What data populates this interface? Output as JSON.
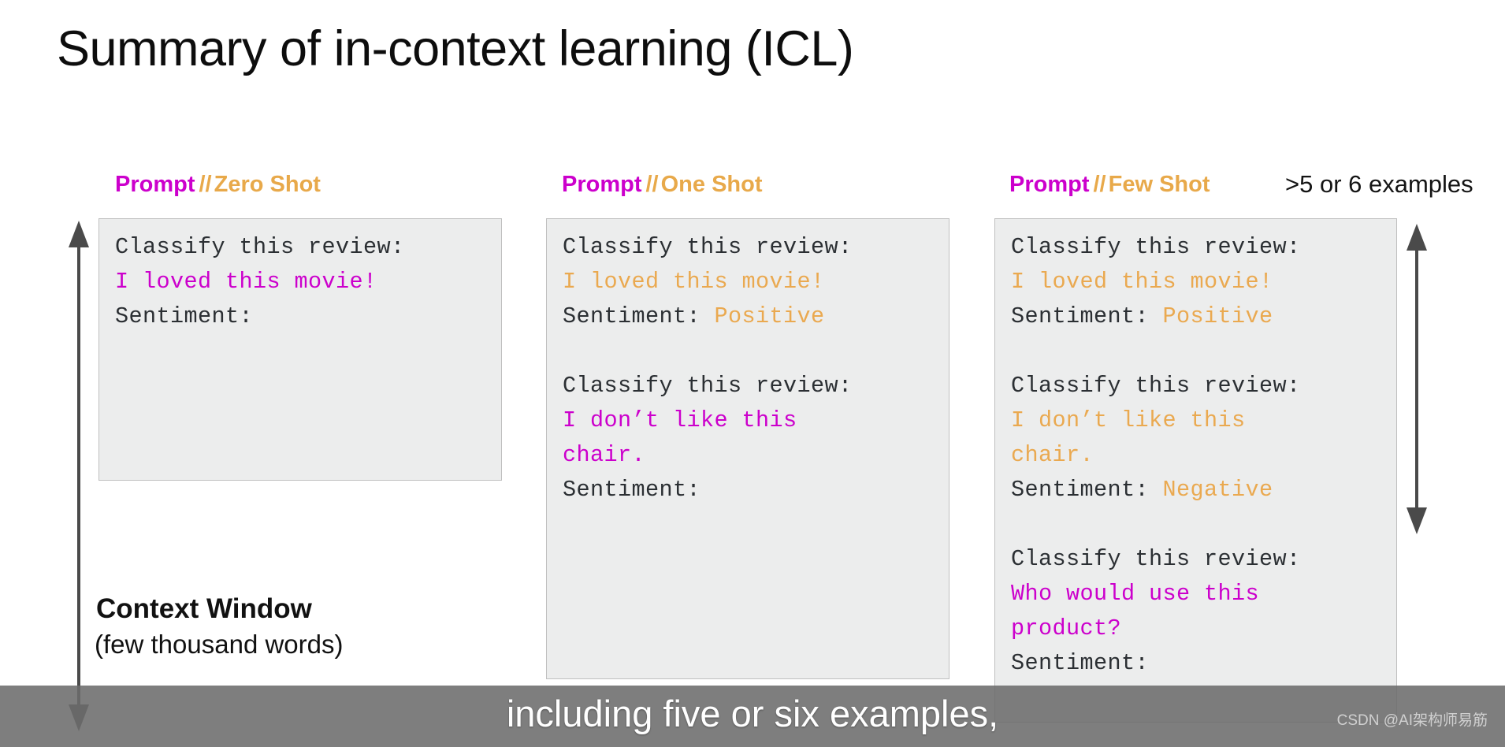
{
  "slide": {
    "title": "Summary of in-context learning (ICL)",
    "background_color": "#ffffff"
  },
  "colors": {
    "magenta": "#cc00cc",
    "orange": "#eaa950",
    "code_dark": "#2b2f33",
    "box_fill": "#eceded",
    "box_border": "#bfbfbf",
    "caption_bar": "#6c6c6c"
  },
  "columns": [
    {
      "header": {
        "prompt_label": "Prompt",
        "separator": "//",
        "shot_label": "Zero Shot"
      },
      "box": {
        "lines": [
          {
            "segments": [
              {
                "text": "Classify this review:",
                "color": "dark"
              }
            ]
          },
          {
            "segments": [
              {
                "text": "I loved this movie!",
                "color": "magenta"
              }
            ]
          },
          {
            "segments": [
              {
                "text": "Sentiment:",
                "color": "dark"
              }
            ]
          }
        ]
      }
    },
    {
      "header": {
        "prompt_label": "Prompt",
        "separator": "//",
        "shot_label": "One Shot"
      },
      "box": {
        "lines": [
          {
            "segments": [
              {
                "text": "Classify this review:",
                "color": "dark"
              }
            ]
          },
          {
            "segments": [
              {
                "text": "I loved this movie!",
                "color": "orange"
              }
            ]
          },
          {
            "segments": [
              {
                "text": "Sentiment: ",
                "color": "dark"
              },
              {
                "text": "Positive",
                "color": "orange"
              }
            ]
          },
          {
            "blank": true
          },
          {
            "segments": [
              {
                "text": "Classify this review:",
                "color": "dark"
              }
            ]
          },
          {
            "segments": [
              {
                "text": "I don’t like this",
                "color": "magenta"
              }
            ]
          },
          {
            "segments": [
              {
                "text": "chair.",
                "color": "magenta"
              }
            ]
          },
          {
            "segments": [
              {
                "text": "Sentiment:",
                "color": "dark"
              }
            ]
          }
        ]
      }
    },
    {
      "header": {
        "prompt_label": "Prompt",
        "separator": "//",
        "shot_label": "Few Shot"
      },
      "note": ">5 or 6 examples",
      "box": {
        "lines": [
          {
            "segments": [
              {
                "text": "Classify this review:",
                "color": "dark"
              }
            ]
          },
          {
            "segments": [
              {
                "text": "I loved this movie!",
                "color": "orange"
              }
            ]
          },
          {
            "segments": [
              {
                "text": "Sentiment: ",
                "color": "dark"
              },
              {
                "text": "Positive",
                "color": "orange"
              }
            ]
          },
          {
            "blank": true
          },
          {
            "segments": [
              {
                "text": "Classify this review:",
                "color": "dark"
              }
            ]
          },
          {
            "segments": [
              {
                "text": "I don’t like this",
                "color": "orange"
              }
            ]
          },
          {
            "segments": [
              {
                "text": "chair.",
                "color": "orange"
              }
            ]
          },
          {
            "segments": [
              {
                "text": "Sentiment: ",
                "color": "dark"
              },
              {
                "text": "Negative",
                "color": "orange"
              }
            ]
          },
          {
            "blank": true
          },
          {
            "segments": [
              {
                "text": "Classify this review:",
                "color": "dark"
              }
            ]
          },
          {
            "segments": [
              {
                "text": "Who would use this",
                "color": "magenta"
              }
            ]
          },
          {
            "segments": [
              {
                "text": "product?",
                "color": "magenta"
              }
            ]
          },
          {
            "segments": [
              {
                "text": "Sentiment:",
                "color": "dark"
              }
            ]
          }
        ]
      }
    }
  ],
  "context_window": {
    "title": "Context Window",
    "subtitle": "(few thousand words)"
  },
  "arrows": {
    "left": {
      "name": "context-window-extent-arrow",
      "direction": "double-vertical"
    },
    "right": {
      "name": "few-shot-examples-extent-arrow",
      "direction": "double-vertical"
    }
  },
  "caption": {
    "text": "including five or six examples,",
    "watermark": "CSDN @AI架构师易筋"
  }
}
